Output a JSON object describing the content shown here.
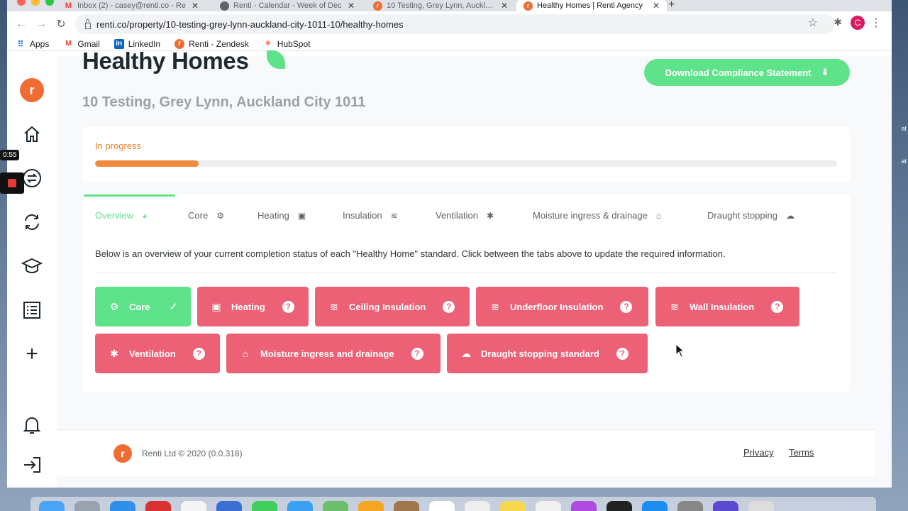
{
  "browser": {
    "tabs": [
      {
        "title": "Inbox (2) - casey@renti.co - Re",
        "fav": "gmail"
      },
      {
        "title": "Renti - Calendar - Week of Dec",
        "fav": "calendar"
      },
      {
        "title": "10 Testing, Grey Lynn, Auckland",
        "fav": "renti"
      },
      {
        "title": "Healthy Homes | Renti Agency",
        "fav": "renti",
        "active": true
      }
    ],
    "url": "renti.co/property/10-testing-grey-lynn-auckland-city-1011-10/healthy-homes",
    "profile_initial": "C",
    "bookmarks": [
      "Apps",
      "Gmail",
      "LinkedIn",
      "Renti - Zendesk",
      "HubSpot"
    ]
  },
  "recorder": {
    "time": "0:55"
  },
  "page": {
    "title": "Healthy Homes",
    "address": "10 Testing, Grey Lynn, Auckland City 1011",
    "download_button": "Download Compliance Statement",
    "status": "In progress",
    "progress_fraction": 0.14,
    "tabs": [
      "Overview",
      "Core",
      "Heating",
      "Insulation",
      "Ventilation",
      "Moisture ingress & drainage",
      "Draught stopping"
    ],
    "overview_text": "Below is an overview of your current completion status of each \"Healthy Home\" standard. Click between the tabs above to update the required information.",
    "standards": [
      {
        "label": "Core",
        "status": "complete",
        "icon": "gear-icon"
      },
      {
        "label": "Heating",
        "status": "incomplete",
        "icon": "heater-icon"
      },
      {
        "label": "Ceiling Insulation",
        "status": "incomplete",
        "icon": "waves-icon"
      },
      {
        "label": "Underfloor Insulation",
        "status": "incomplete",
        "icon": "waves-icon"
      },
      {
        "label": "Wall Insulation",
        "status": "incomplete",
        "icon": "waves-icon"
      },
      {
        "label": "Ventilation",
        "status": "incomplete",
        "icon": "snowflake-icon"
      },
      {
        "label": "Moisture ingress and drainage",
        "status": "incomplete",
        "icon": "house-icon"
      },
      {
        "label": "Draught stopping standard",
        "status": "incomplete",
        "icon": "cloud-icon"
      }
    ],
    "footer": {
      "copyright": "Renti Ltd © 2020 (0.0.318)",
      "privacy": "Privacy",
      "terms": "Terms"
    }
  },
  "colors": {
    "accent_green": "#5fe38a",
    "incomplete_red": "#ec6175",
    "progress_orange": "#f08a3e",
    "brand_orange": "#ef6c33"
  }
}
